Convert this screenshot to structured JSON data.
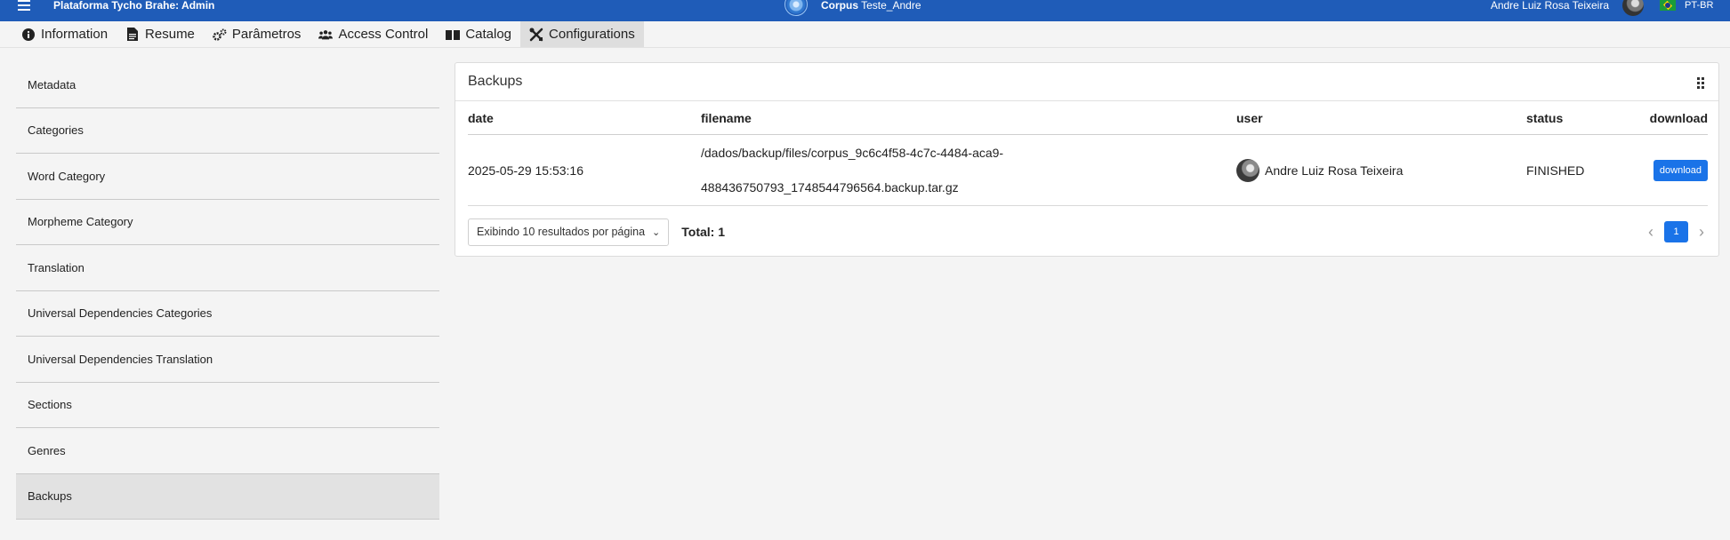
{
  "topbar": {
    "app_title": "Plataforma Tycho Brahe: Admin",
    "corpus_label": "Corpus",
    "corpus_name": "Teste_Andre",
    "user_name": "Andre Luiz Rosa Teixeira",
    "language": "PT-BR"
  },
  "tabs": [
    {
      "label": "Information",
      "icon": "info-icon"
    },
    {
      "label": "Resume",
      "icon": "document-icon"
    },
    {
      "label": "Parâmetros",
      "icon": "gears-icon"
    },
    {
      "label": "Access Control",
      "icon": "users-icon"
    },
    {
      "label": "Catalog",
      "icon": "book-icon"
    },
    {
      "label": "Configurations",
      "icon": "tools-icon"
    }
  ],
  "sidebar": {
    "items": [
      {
        "label": "Metadata"
      },
      {
        "label": "Categories"
      },
      {
        "label": "Word Category"
      },
      {
        "label": "Morpheme Category"
      },
      {
        "label": "Translation"
      },
      {
        "label": "Universal Dependencies Categories"
      },
      {
        "label": "Universal Dependencies Translation"
      },
      {
        "label": "Sections"
      },
      {
        "label": "Genres"
      },
      {
        "label": "Backups"
      }
    ],
    "active": "Backups"
  },
  "panel": {
    "title": "Backups",
    "columns": {
      "date": "date",
      "filename": "filename",
      "user": "user",
      "status": "status",
      "download": "download"
    },
    "rows": [
      {
        "date": "2025-05-29 15:53:16",
        "filename_line1": "/dados/backup/files/corpus_9c6c4f58-4c7c-4484-aca9-",
        "filename_line2": "488436750793_1748544796564.backup.tar.gz",
        "user": "Andre Luiz Rosa Teixeira",
        "status": "FINISHED",
        "download_label": "download"
      }
    ],
    "page_size_label": "Exibindo 10 resultados por página",
    "total_label": "Total: 1",
    "current_page": "1"
  },
  "colors": {
    "topbar": "#1f5cb8",
    "accent": "#1a73e8"
  }
}
